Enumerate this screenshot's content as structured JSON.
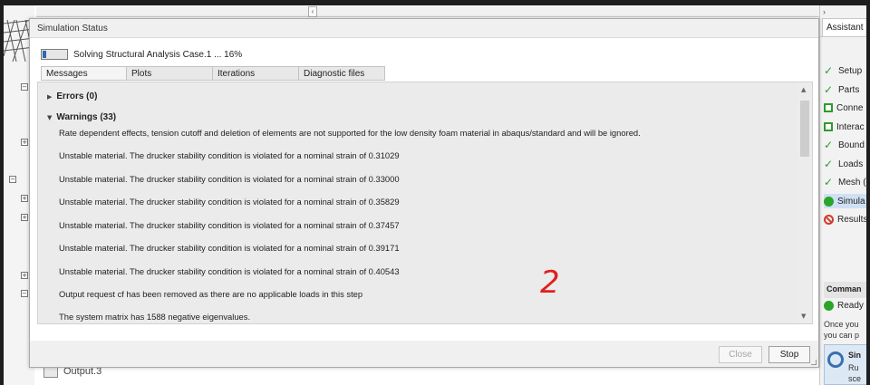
{
  "background": {
    "output_label": "Output.3",
    "scroll_arrow": "‹"
  },
  "assistant": {
    "collapse_arrow": "›",
    "tab_label": "Assistant",
    "steps": [
      {
        "label": "Setup",
        "status": "done"
      },
      {
        "label": "Parts",
        "status": "done"
      },
      {
        "label": "Conne",
        "status": "todo"
      },
      {
        "label": "Interac",
        "status": "todo"
      },
      {
        "label": "Bound",
        "status": "done"
      },
      {
        "label": "Loads",
        "status": "done"
      },
      {
        "label": "Mesh (",
        "status": "done"
      },
      {
        "label": "Simula",
        "status": "running"
      },
      {
        "label": "Results",
        "status": "blocked"
      }
    ],
    "command_header": "Comman",
    "ready_label": "Ready",
    "info_line1": "Once you",
    "info_line2": "you can p",
    "sim_title": "Sin",
    "sim_desc1": "Ru",
    "sim_desc2": "sce"
  },
  "dialog": {
    "title": "Simulation Status",
    "progress": {
      "percent": 16,
      "text": "Solving Structural Analysis Case.1 ... 16%"
    },
    "tabs": [
      "Messages",
      "Plots",
      "Iterations",
      "Diagnostic files"
    ],
    "errors_header": "Errors (0)",
    "warnings_header": "Warnings (33)",
    "messages": [
      "Rate dependent effects, tension cutoff and deletion of elements are not supported for the low density foam material in abaqus/standard and will be ignored.",
      "Unstable material. The drucker stability condition is violated for a nominal strain of 0.31029",
      "Unstable material. The drucker stability condition is violated for a nominal strain of 0.33000",
      "Unstable material. The drucker stability condition is violated for a nominal strain of 0.35829",
      "Unstable material. The drucker stability condition is violated for a nominal strain of 0.37457",
      "Unstable material. The drucker stability condition is violated for a nominal strain of 0.39171",
      "Unstable material. The drucker stability condition is violated for a nominal strain of 0.40543",
      "Output request cf has been removed as there are no applicable loads in this step",
      "The system matrix has 1588 negative eigenvalues."
    ],
    "annotation": "2",
    "close_label": "Close",
    "stop_label": "Stop"
  },
  "colors": {
    "progress_fill": "#2f67b2",
    "check": "#2e9a2e",
    "blocked": "#d23a2a",
    "annotation": "#e02020"
  }
}
